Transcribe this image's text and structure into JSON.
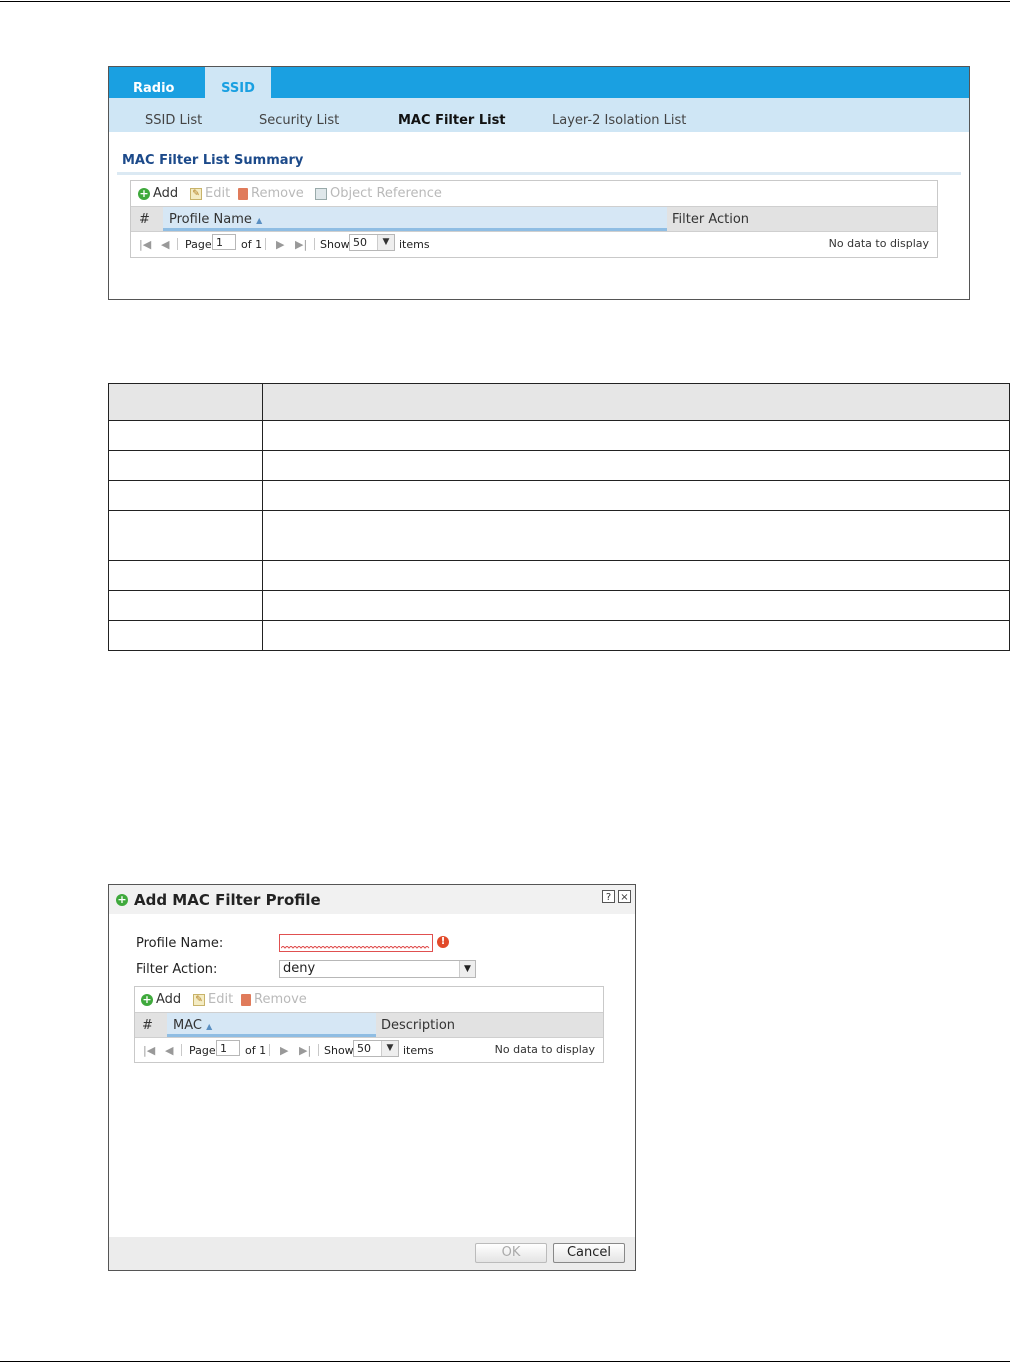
{
  "screen1": {
    "tabs": [
      {
        "label": "Radio"
      },
      {
        "label": "SSID"
      }
    ],
    "subtabs": [
      {
        "label": "SSID List"
      },
      {
        "label": "Security List"
      },
      {
        "label": "MAC Filter List"
      },
      {
        "label": "Layer-2 Isolation List"
      }
    ],
    "section_title": "MAC Filter List Summary",
    "toolbar": {
      "add": "Add",
      "edit": "Edit",
      "remove": "Remove",
      "object_reference": "Object Reference"
    },
    "columns": {
      "index": "#",
      "profile_name": "Profile Name",
      "filter_action": "Filter Action"
    },
    "pager": {
      "page_label": "Page",
      "page_value": "1",
      "of_label": "of 1",
      "show_label": "Show",
      "show_value": "50",
      "items_label": "items",
      "no_data": "No data to display"
    }
  },
  "dialog": {
    "title": "Add MAC Filter Profile",
    "help": "?",
    "close": "×",
    "profile_name_label": "Profile Name:",
    "profile_name_value": "",
    "filter_action_label": "Filter Action:",
    "filter_action_value": "deny",
    "toolbar": {
      "add": "Add",
      "edit": "Edit",
      "remove": "Remove"
    },
    "columns": {
      "index": "#",
      "mac": "MAC",
      "description": "Description"
    },
    "pager": {
      "page_label": "Page",
      "page_value": "1",
      "of_label": "of 1",
      "show_label": "Show",
      "show_value": "50",
      "items_label": "items",
      "no_data": "No data to display"
    },
    "ok_label": "OK",
    "cancel_label": "Cancel"
  },
  "colors": {
    "accent": "#1aa0e1",
    "subtab_bg": "#cfe6f5",
    "title_blue": "#1c4a8a",
    "add_green": "#3fa93c",
    "error_red": "#e24a2a"
  }
}
